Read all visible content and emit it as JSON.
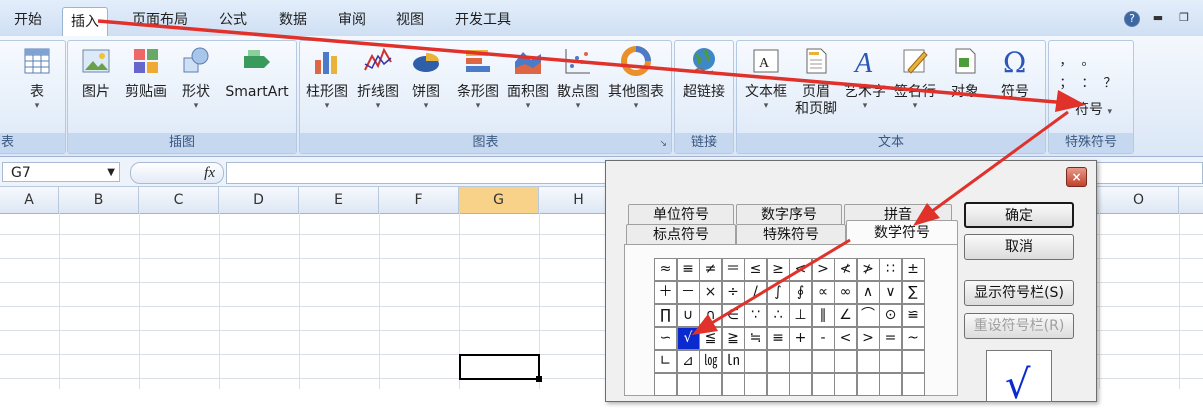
{
  "ribbon": {
    "tabs": [
      "开始",
      "插入",
      "页面布局",
      "公式",
      "数据",
      "审阅",
      "视图",
      "开发工具"
    ],
    "active_tab": "插入",
    "groups": {
      "table": {
        "label": "表",
        "button": "表"
      },
      "illustrations": {
        "label": "插图",
        "buttons": [
          "图片",
          "剪贴画",
          "形状",
          "SmartArt"
        ]
      },
      "charts": {
        "label": "图表",
        "buttons": [
          "柱形图",
          "折线图",
          "饼图",
          "条形图",
          "面积图",
          "散点图",
          "其他图表"
        ]
      },
      "links": {
        "label": "链接",
        "button": "超链接"
      },
      "text": {
        "label": "文本",
        "buttons": [
          "文本框",
          "页眉",
          "和页脚",
          "艺术字",
          "签名行",
          "对象",
          "符号"
        ]
      },
      "special": {
        "label": "特殊符号",
        "mini_symbols": [
          "，",
          "。",
          "；",
          "：",
          "？"
        ],
        "button": "符号"
      }
    }
  },
  "formula_bar": {
    "name_box": "G7",
    "fx": "fx",
    "value": ""
  },
  "columns": [
    "A",
    "B",
    "C",
    "D",
    "E",
    "F",
    "G",
    "H",
    "O"
  ],
  "selected_column": "G",
  "dialog": {
    "tabs_row1": [
      "单位符号",
      "数字序号",
      "拼音"
    ],
    "tabs_row2": [
      "标点符号",
      "特殊符号",
      "数学符号"
    ],
    "active_tab": "数学符号",
    "symbols": [
      [
        "≈",
        "≡",
        "≠",
        "＝",
        "≤",
        "≥",
        "<",
        ">",
        "≮",
        "≯",
        "∷",
        "±"
      ],
      [
        "＋",
        "－",
        "×",
        "÷",
        "/",
        "∫",
        "∮",
        "∝",
        "∞",
        "∧",
        "∨",
        "∑"
      ],
      [
        "∏",
        "∪",
        "∩",
        "∈",
        "∵",
        "∴",
        "⊥",
        "∥",
        "∠",
        "⌒",
        "⊙",
        "≌"
      ],
      [
        "∽",
        "√",
        "≦",
        "≧",
        "≒",
        "≡",
        "+",
        "-",
        "<",
        ">",
        "=",
        "~"
      ],
      [
        "∟",
        "⊿",
        "㏒",
        "㏑",
        "",
        "",
        "",
        "",
        "",
        "",
        "",
        ""
      ],
      [
        "",
        "",
        "",
        "",
        "",
        "",
        "",
        "",
        "",
        "",
        "",
        ""
      ]
    ],
    "selected_symbol": "√",
    "buttons": {
      "ok": "确定",
      "cancel": "取消",
      "show_bar": "显示符号栏(S)",
      "reset_bar": "重设符号栏(R)"
    },
    "preview_symbol": "√",
    "close_icon": "×"
  },
  "colors": {
    "arrow": "#e0312b",
    "selected_cell": "#0a2ad0",
    "selected_column": "#f9d28a"
  }
}
